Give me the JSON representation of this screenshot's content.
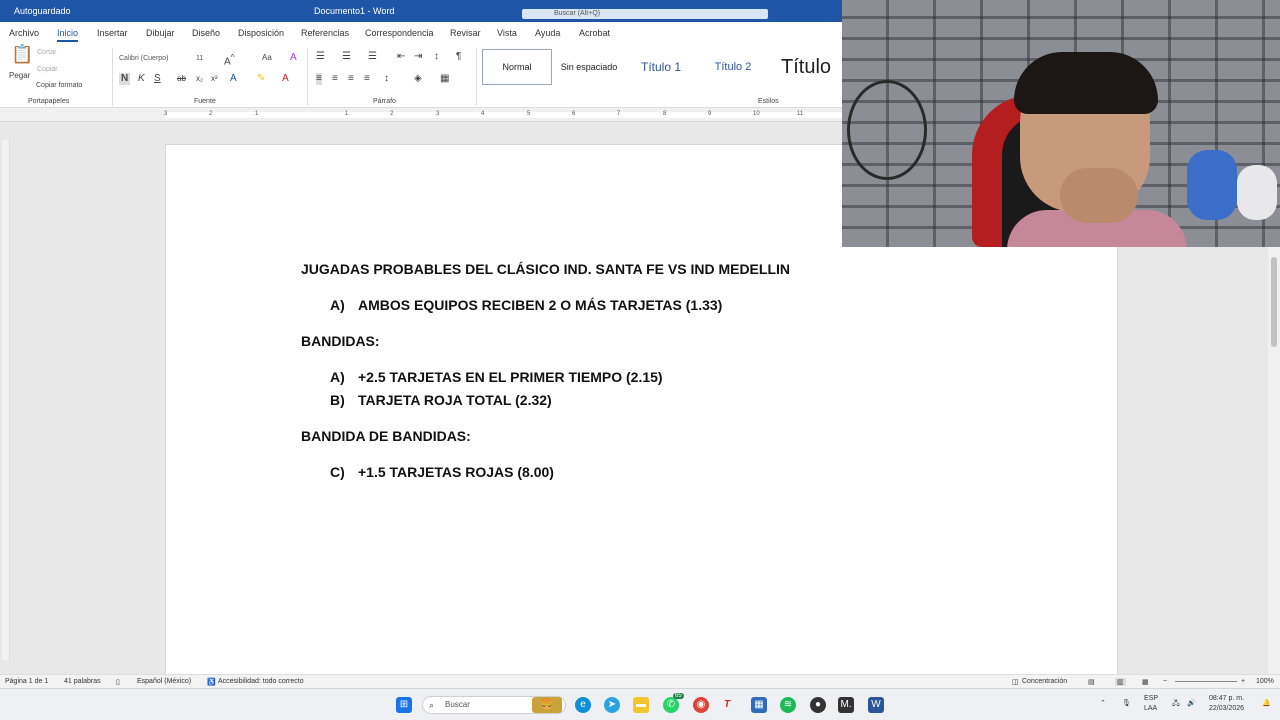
{
  "window": {
    "title_left": "Autoguardado",
    "doc_title": "Documento1 - Word",
    "search_placeholder": "Buscar (Alt+Q)"
  },
  "ribbon_tabs": [
    "Archivo",
    "Inicio",
    "Insertar",
    "Dibujar",
    "Diseño",
    "Disposición",
    "Referencias",
    "Correspondencia",
    "Revisar",
    "Vista",
    "Ayuda",
    "Acrobat"
  ],
  "ribbon": {
    "paste_label": "Pegar",
    "cut_label": "Cortar",
    "copy_label": "Copiar",
    "format_painter_label": "Copiar formato",
    "font_name": "Calibri (Cuerpo)",
    "font_size": "11",
    "groups": {
      "clipboard": "Portapapeles",
      "font": "Fuente",
      "paragraph": "Párrafo",
      "styles": "Estilos"
    },
    "styles": [
      "Normal",
      "Sin espaciado",
      "Título 1",
      "Título 2",
      "Título"
    ]
  },
  "ruler_numbers": [
    "3",
    "2",
    "1",
    "1",
    "2",
    "3",
    "4",
    "5",
    "6",
    "7",
    "8",
    "9",
    "10",
    "11"
  ],
  "document": {
    "title": "JUGADAS PROBABLES DEL CLÁSICO IND. SANTA FE VS IND MEDELLIN",
    "list1": [
      {
        "letter": "A)",
        "text": "AMBOS EQUIPOS RECIBEN 2 O MÁS TARJETAS (1.33)"
      }
    ],
    "heading2": "BANDIDAS:",
    "list2": [
      {
        "letter": "A)",
        "text": "+2.5 TARJETAS EN EL PRIMER TIEMPO (2.15)"
      },
      {
        "letter": "B)",
        "text": "TARJETA ROJA TOTAL (2.32)"
      }
    ],
    "heading3": "BANDIDA DE BANDIDAS:",
    "list3": [
      {
        "letter": "C)",
        "text": "+1.5 TARJETAS ROJAS (8.00)"
      }
    ]
  },
  "statusbar": {
    "page": "Página 1 de 1",
    "words": "41 palabras",
    "language": "Español (México)",
    "accessibility": "Accesibilidad: todo correcto",
    "focus": "Concentración",
    "zoom": "100%"
  },
  "taskbar": {
    "search_placeholder": "Buscar",
    "whatsapp_badge": "65",
    "lang_top": "ESP",
    "lang_bottom": "LAA",
    "time": "08:47 p. m.",
    "date": "22/03/2026"
  },
  "colors": {
    "accent": "#1f56a8",
    "webcam_wall": "#7c8087",
    "chair": "#b41e1e"
  }
}
